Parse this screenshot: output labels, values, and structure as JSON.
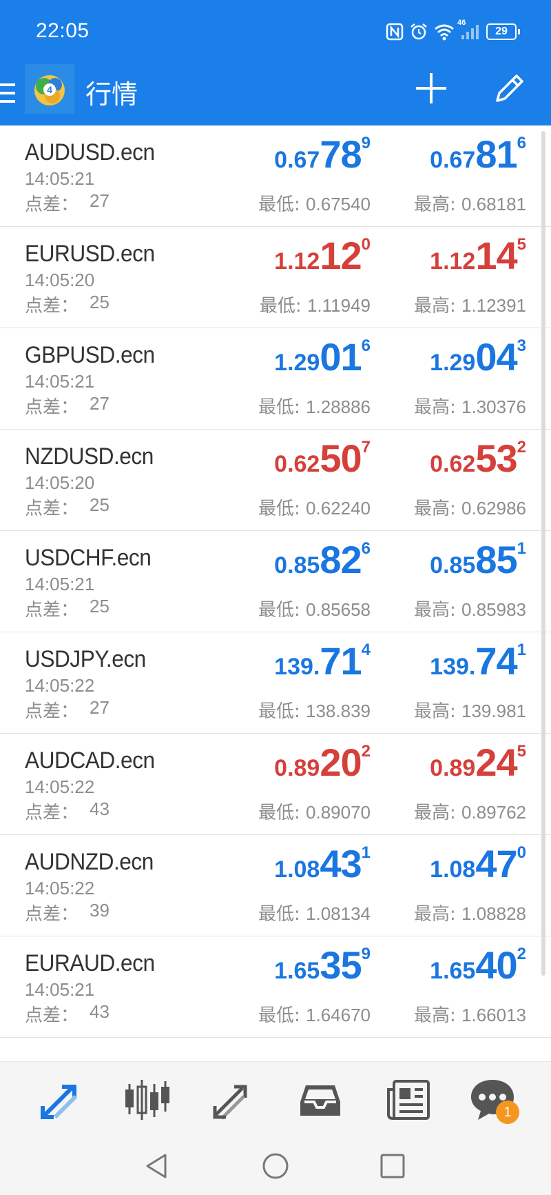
{
  "status_bar": {
    "time": "22:05",
    "network": "46",
    "battery": "29",
    "icons": [
      "nfc-icon",
      "alarm-icon",
      "wifi-icon",
      "signal-icon",
      "battery-icon"
    ]
  },
  "app_bar": {
    "title": "行情",
    "icons": [
      "menu-icon",
      "app-logo",
      "add-icon",
      "edit-icon"
    ]
  },
  "colors": {
    "primary": "#1a7fe8",
    "price_up": "#1a76e0",
    "price_down": "#d5403b",
    "muted_text": "#8d8d8d",
    "badge": "#f5961f"
  },
  "labels": {
    "spread": "点差：",
    "low": "最低: ",
    "high": "最高: "
  },
  "quotes": [
    {
      "symbol": "AUDUSD.ecn",
      "time": "14:05:21",
      "spread": "27",
      "bid": {
        "small": "0.67",
        "big": "78",
        "sup": "9"
      },
      "ask": {
        "small": "0.67",
        "big": "81",
        "sup": "6"
      },
      "low": "0.67540",
      "high": "0.68181",
      "direction": "up"
    },
    {
      "symbol": "EURUSD.ecn",
      "time": "14:05:20",
      "spread": "25",
      "bid": {
        "small": "1.12",
        "big": "12",
        "sup": "0"
      },
      "ask": {
        "small": "1.12",
        "big": "14",
        "sup": "5"
      },
      "low": "1.11949",
      "high": "1.12391",
      "direction": "down"
    },
    {
      "symbol": "GBPUSD.ecn",
      "time": "14:05:21",
      "spread": "27",
      "bid": {
        "small": "1.29",
        "big": "01",
        "sup": "6"
      },
      "ask": {
        "small": "1.29",
        "big": "04",
        "sup": "3"
      },
      "low": "1.28886",
      "high": "1.30376",
      "direction": "up"
    },
    {
      "symbol": "NZDUSD.ecn",
      "time": "14:05:20",
      "spread": "25",
      "bid": {
        "small": "0.62",
        "big": "50",
        "sup": "7"
      },
      "ask": {
        "small": "0.62",
        "big": "53",
        "sup": "2"
      },
      "low": "0.62240",
      "high": "0.62986",
      "direction": "down"
    },
    {
      "symbol": "USDCHF.ecn",
      "time": "14:05:21",
      "spread": "25",
      "bid": {
        "small": "0.85",
        "big": "82",
        "sup": "6"
      },
      "ask": {
        "small": "0.85",
        "big": "85",
        "sup": "1"
      },
      "low": "0.85658",
      "high": "0.85983",
      "direction": "up"
    },
    {
      "symbol": "USDJPY.ecn",
      "time": "14:05:22",
      "spread": "27",
      "bid": {
        "small": "139.",
        "big": "71",
        "sup": "4"
      },
      "ask": {
        "small": "139.",
        "big": "74",
        "sup": "1"
      },
      "low": "138.839",
      "high": "139.981",
      "direction": "up"
    },
    {
      "symbol": "AUDCAD.ecn",
      "time": "14:05:22",
      "spread": "43",
      "bid": {
        "small": "0.89",
        "big": "20",
        "sup": "2"
      },
      "ask": {
        "small": "0.89",
        "big": "24",
        "sup": "5"
      },
      "low": "0.89070",
      "high": "0.89762",
      "direction": "down"
    },
    {
      "symbol": "AUDNZD.ecn",
      "time": "14:05:22",
      "spread": "39",
      "bid": {
        "small": "1.08",
        "big": "43",
        "sup": "1"
      },
      "ask": {
        "small": "1.08",
        "big": "47",
        "sup": "0"
      },
      "low": "1.08134",
      "high": "1.08828",
      "direction": "up"
    },
    {
      "symbol": "EURAUD.ecn",
      "time": "14:05:21",
      "spread": "43",
      "bid": {
        "small": "1.65",
        "big": "35",
        "sup": "9"
      },
      "ask": {
        "small": "1.65",
        "big": "40",
        "sup": "2"
      },
      "low": "1.64670",
      "high": "1.66013",
      "direction": "up"
    }
  ],
  "bottom_nav": {
    "items": [
      "quotes-icon",
      "chart-icon",
      "trade-icon",
      "history-icon",
      "news-icon",
      "messages-icon"
    ],
    "active": "quotes-icon",
    "messages_badge": "1"
  },
  "system_nav": {
    "items": [
      "back-icon",
      "home-icon",
      "recents-icon"
    ]
  }
}
